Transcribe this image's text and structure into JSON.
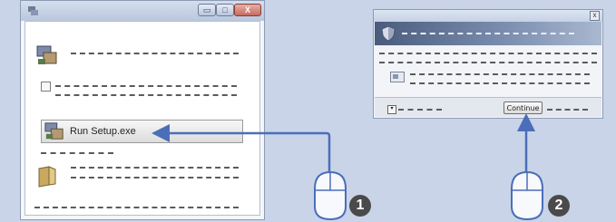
{
  "left_window": {
    "buttons": {
      "minimize_glyph": "▭",
      "maximize_glyph": "□",
      "close_glyph": "X"
    },
    "run_item_label": "Run Setup.exe"
  },
  "right_window": {
    "close_glyph": "x",
    "continue_label": "Continue"
  },
  "steps": [
    "1",
    "2"
  ],
  "icons": [
    "setup-installer-icon",
    "shield-icon",
    "folder-icon",
    "mouse-icon",
    "arrow-icon"
  ],
  "colors": {
    "background": "#c9d4e9",
    "arrow": "#4a6fb8",
    "badge": "#4a4a4a"
  }
}
